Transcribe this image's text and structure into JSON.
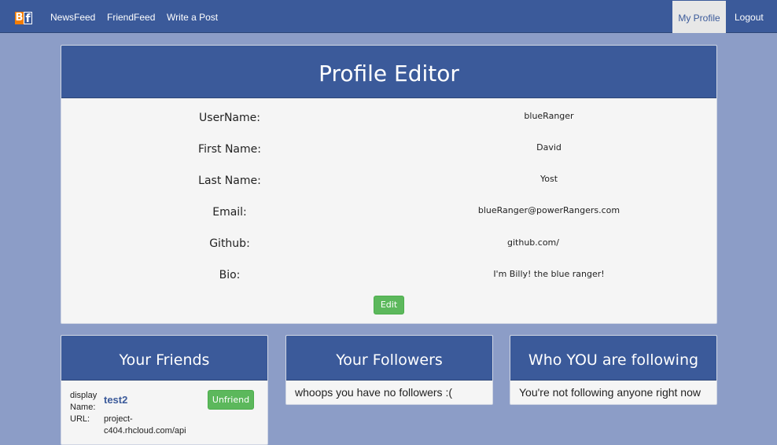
{
  "nav": {
    "brand": "BF",
    "brand_b": "B",
    "brand_f": "f",
    "links": [
      "NewsFeed",
      "FriendFeed",
      "Write a Post"
    ],
    "active": "My Profile",
    "logout": "Logout"
  },
  "editor": {
    "title": "Profile Editor",
    "fields": [
      {
        "label": "UserName:",
        "value": "blueRanger"
      },
      {
        "label": "First Name:",
        "value": "David"
      },
      {
        "label": "Last Name:",
        "value": "Yost"
      },
      {
        "label": "Email:",
        "value": "blueRanger@powerRangers.com"
      },
      {
        "label": "Github:",
        "value": "github.com/"
      },
      {
        "label": "Bio:",
        "value": "I'm Billy! the blue ranger!"
      }
    ],
    "edit_label": "Edit"
  },
  "friends": {
    "title": "Your Friends",
    "item": {
      "display_label": "display Name:",
      "display_label_1": "display",
      "display_label_2": "Name:",
      "name": "test2",
      "url_label": "URL:",
      "url_value_1": "project-",
      "url_value_2": "c404.rhcloud.com/api",
      "unfriend_label": "Unfriend"
    }
  },
  "followers": {
    "title": "Your Followers",
    "empty": "whoops you have no followers :("
  },
  "following": {
    "title": "Who YOU are following",
    "empty": "You're not following anyone right now"
  },
  "colors": {
    "nav": "#3b5a9a",
    "background": "#8c9dc7",
    "button": "#5cb85c",
    "brand_orange": "#f57d00"
  }
}
